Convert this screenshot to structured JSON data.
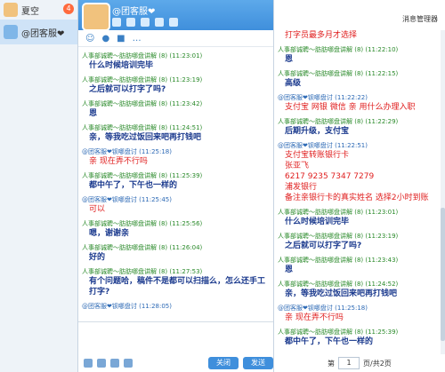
{
  "contacts": [
    {
      "name": "夏空",
      "badge": "4"
    },
    {
      "name": "@团客服❤"
    }
  ],
  "chat": {
    "title": "@团客服❤",
    "messages": [
      {
        "from": "人事部诚聘～肪肪哪盘讲解 (8) (11:23:01)",
        "text": "什么时候培训完毕"
      },
      {
        "from": "人事部诚聘～肪肪哪盘讲解 (8) (11:23:19)",
        "text": "之后就可以打字了吗?"
      },
      {
        "from": "人事部诚聘～肪肪哪盘讲解 (8) (11:23:42)",
        "text": "恩"
      },
      {
        "from": "人事部诚聘～肪肪哪盘讲解 (8) (11:24:51)",
        "text": "亲，等我吃过饭回来吧再打钱吧"
      },
      {
        "from": "@团客服❤钡哪盘讨 (11:25:18)",
        "text": "亲 现在弄不行吗",
        "me": true
      },
      {
        "from": "人事部诚聘～肪肪哪盘讲解 (8) (11:25:39)",
        "text": "都中午了，下午也一样的"
      },
      {
        "from": "@团客服❤钡哪盘讨 (11:25:45)",
        "text": "可以",
        "me": true
      },
      {
        "from": "人事部诚聘～肪肪哪盘讲解 (8) (11:25:56)",
        "text": "嗯，谢谢亲"
      },
      {
        "from": "人事部诚聘～肪肪哪盘讲解 (8) (11:26:04)",
        "text": "好的"
      },
      {
        "from": "人事部诚聘～肪肪哪盘讲解 (8) (11:27:53)",
        "text": "有个问题哈，稿件不是都可以扫描么，怎么还手工打字?"
      },
      {
        "from": "@团客服❤钡哪盘讨 (11:28:05)",
        "text": "",
        "me": true
      }
    ],
    "send_label": "发送",
    "close_label": "关闭"
  },
  "history": {
    "manager_label": "消息管理器",
    "messages": [
      {
        "from": "",
        "text": "打字员最多月才选择",
        "me": true
      },
      {
        "from": "人事部诚聘～肪肪哪盘讲解 (8) (11:22:10)",
        "text": "恩"
      },
      {
        "from": "人事部诚聘～肪肪哪盘讲解 (8) (11:22:15)",
        "text": "高级"
      },
      {
        "from": "@团客服❤钡哪盘讨 (11:22:22)",
        "text": "支付宝 网银 微信 亲 用什么办理入职",
        "me": true
      },
      {
        "from": "人事部诚聘～肪肪哪盘讲解 (8) (11:22:29)",
        "text": "后期升级，支付宝"
      },
      {
        "from": "@团客服❤钡哪盘讨 (11:22:51)",
        "text": "支付宝转账银行卡\n张亚飞\n6217 9235 7347 7279\n浦发银行\n备注亲银行卡的真实姓名 选择2小时到账",
        "me": true
      },
      {
        "from": "人事部诚聘～肪肪哪盘讲解 (8) (11:23:01)",
        "text": "什么时候培训完毕"
      },
      {
        "from": "人事部诚聘～肪肪哪盘讲解 (8) (11:23:19)",
        "text": "之后就可以打字了吗?"
      },
      {
        "from": "人事部诚聘～肪肪哪盘讲解 (8) (11:23:43)",
        "text": "恩"
      },
      {
        "from": "人事部诚聘～肪肪哪盘讲解 (8) (11:24:52)",
        "text": "亲，等我吃过饭回来吧再打钱吧"
      },
      {
        "from": "@团客服❤钡哪盘讨 (11:25:18)",
        "text": "亲 现在弄不行吗",
        "me": true
      },
      {
        "from": "人事部诚聘～肪肪哪盘讲解 (8) (11:25:39)",
        "text": "都中午了，下午也一样的"
      }
    ],
    "page_label": "第",
    "page": "1",
    "page_total": "页/共2页"
  }
}
